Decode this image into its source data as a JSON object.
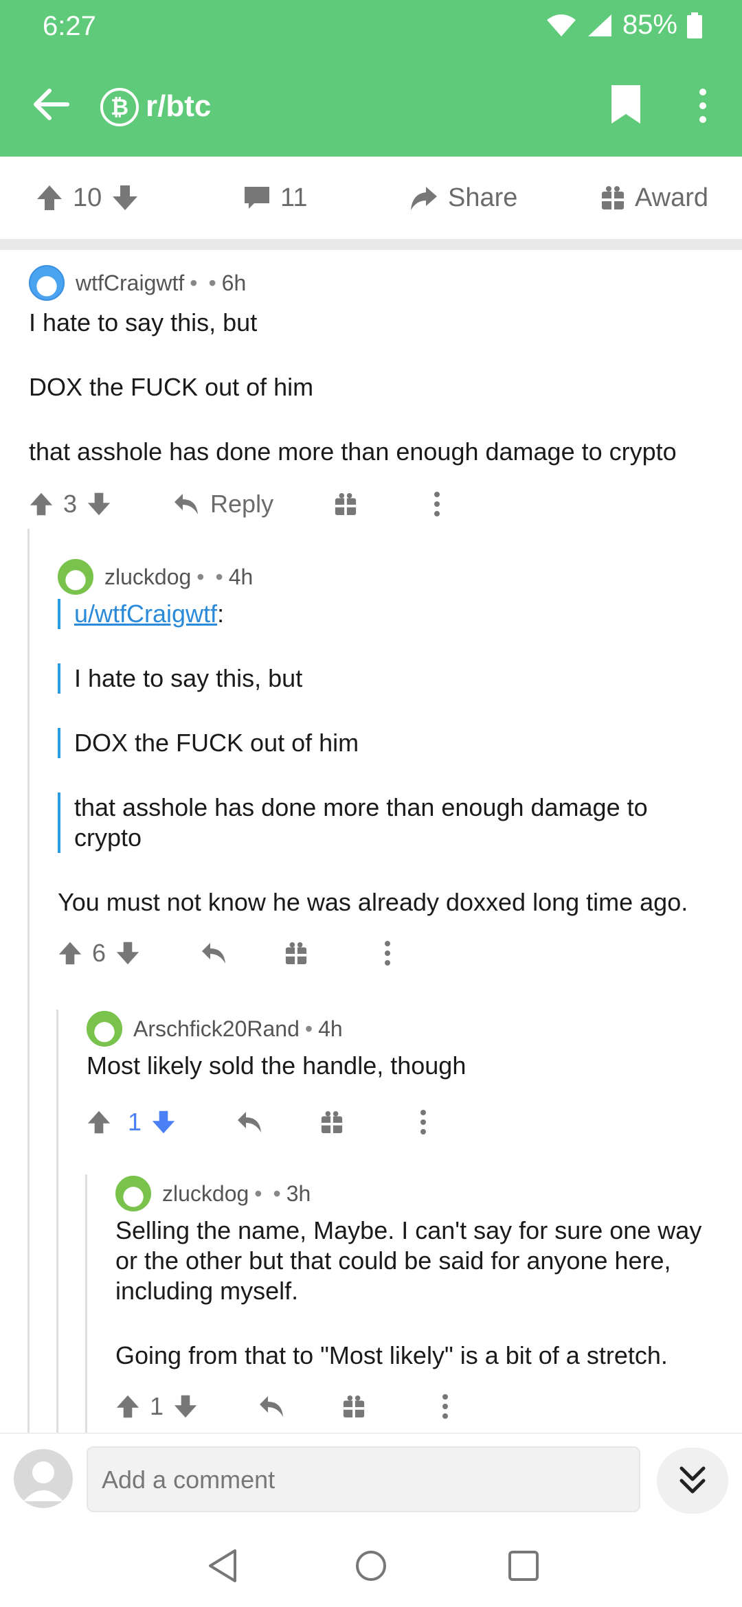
{
  "status": {
    "time": "6:27",
    "battery": "85%"
  },
  "toolbar": {
    "subreddit": "r/btc"
  },
  "actions": {
    "score": "10",
    "comments": "11",
    "share": "Share",
    "award": "Award"
  },
  "comments": [
    {
      "author": "wtfCraigwtf",
      "age": "6h",
      "paragraphs": [
        "I hate to say this, but",
        "DOX the FUCK out of him",
        "that asshole has done more than enough damage to crypto"
      ],
      "score": "3",
      "reply": "Reply"
    },
    {
      "author": "zluckdog",
      "age": "4h",
      "quote_user": "u/wtfCraigwtf",
      "quote_lines": [
        "I hate to say this, but",
        "DOX the FUCK out of him",
        "that asshole has done more than enough damage to crypto"
      ],
      "text": "You must not know he was already doxxed long time ago.",
      "score": "6"
    },
    {
      "author": "Arschfick20Rand",
      "age": "4h",
      "text": "Most likely sold the handle, though",
      "score": "1"
    },
    {
      "author": "zluckdog",
      "age": "3h",
      "paragraphs": [
        "Selling the name, Maybe. I can't say for sure one way or the other but that could be said for anyone here, including myself.",
        "Going from that to \"Most likely\" is a bit of a stretch."
      ],
      "score": "1"
    }
  ],
  "composer": {
    "placeholder": "Add a comment"
  },
  "colors": {
    "header": "#5fcb7a",
    "link": "#2a8ad9",
    "downvote_active": "#4a7ff5",
    "quote_bar": "#2a9de0"
  }
}
